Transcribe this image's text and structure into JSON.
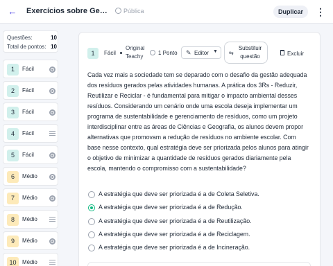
{
  "header": {
    "back_icon": "arrow-left-icon",
    "title": "Exercícios sobre Gestão de Resíduos",
    "visibility": "Pública",
    "visibility_icon": "globe-icon",
    "duplicate_label": "Duplicar",
    "more_icon": "vertical-dots-icon"
  },
  "stats": {
    "questions_label": "Questões:",
    "questions_value": "10",
    "points_label": "Total de pontos:",
    "points_value": "10"
  },
  "question_list": [
    {
      "number": "1",
      "level": "Fácil",
      "kind": "multiple-choice"
    },
    {
      "number": "2",
      "level": "Fácil",
      "kind": "multiple-choice"
    },
    {
      "number": "3",
      "level": "Fácil",
      "kind": "multiple-choice"
    },
    {
      "number": "4",
      "level": "Fácil",
      "kind": "open-text"
    },
    {
      "number": "5",
      "level": "Fácil",
      "kind": "multiple-choice"
    },
    {
      "number": "6",
      "level": "Médio",
      "kind": "multiple-choice"
    },
    {
      "number": "7",
      "level": "Médio",
      "kind": "multiple-choice"
    },
    {
      "number": "8",
      "level": "Médio",
      "kind": "open-text"
    },
    {
      "number": "9",
      "level": "Médio",
      "kind": "multiple-choice"
    },
    {
      "number": "10",
      "level": "Médio",
      "kind": "open-text"
    }
  ],
  "question": {
    "number": "1",
    "level": "Fácil",
    "origin": "Original Teachy",
    "points": "1 Ponto",
    "editor_label": "Editor",
    "replace_label": "Substituir questão",
    "delete_label": "Excluir",
    "text": "Cada vez mais a sociedade tem se deparado com o desafio da gestão adequada dos resíduos gerados pelas atividades humanas. A prática dos 3Rs - Reduzir, Reutilizar e Reciclar - é fundamental para mitigar o impacto ambiental desses resíduos. Considerando um cenário onde uma escola deseja implementar um programa de sustentabilidade e gerenciamento de resíduos, como um projeto interdisciplinar entre as áreas de Ciências e Geografia, os alunos devem propor alternativas que promovam a redução de resíduos no ambiente escolar. Com base nesse contexto, qual estratégia deve ser priorizada pelos alunos para atingir o objetivo de minimizar a quantidade de resíduos gerados diariamente pela escola, mantendo o compromisso com a sustentabilidade?",
    "options": [
      {
        "text": "A estratégia que deve ser priorizada é a de Coleta Seletiva.",
        "selected": false
      },
      {
        "text": "A estratégia que deve ser priorizada é a de Redução.",
        "selected": true
      },
      {
        "text": "A estratégia que deve ser priorizada é a de Reutilização.",
        "selected": false
      },
      {
        "text": "A estratégia que deve ser priorizada é a de Reciclagem.",
        "selected": false
      },
      {
        "text": "A estratégia que deve ser priorizada é a de Incineração.",
        "selected": false
      }
    ]
  },
  "colors": {
    "accent": "#4f46e5",
    "easy_badge": "#d1f0ec",
    "medium_badge": "#fdeab9",
    "selected_option": "#10b981"
  }
}
